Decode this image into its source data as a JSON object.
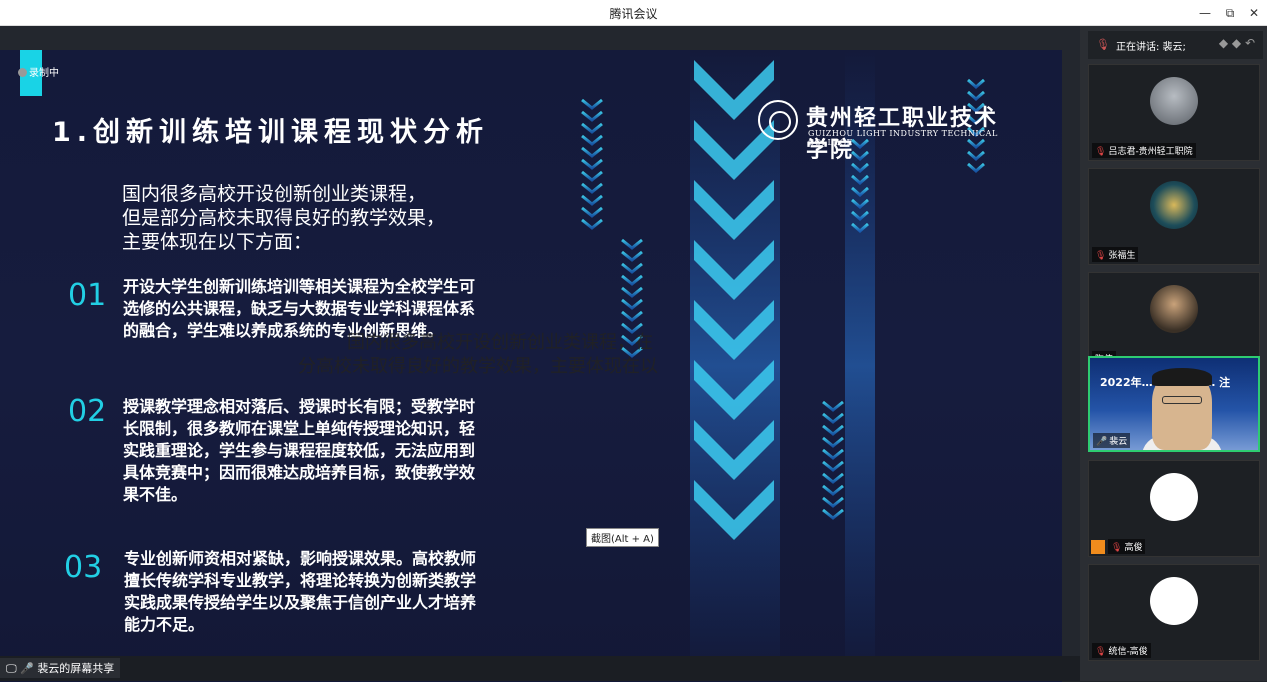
{
  "window": {
    "title": "腾讯会议",
    "minimize": "—",
    "restore": "⧉",
    "close": "✕"
  },
  "recording": {
    "label": "录制中"
  },
  "slide": {
    "title": "1.创新训练培训课程现状分析",
    "logo": {
      "cn": "贵州轻工职业技术学院",
      "en": "GUIZHOU LIGHT INDUSTRY TECHNICAL COLLEGE"
    },
    "intro": [
      "国内很多高校开设创新创业类课程，",
      "但是部分高校未取得良好的教学效果，",
      "主要体现在以下方面："
    ],
    "points": [
      {
        "num": "01",
        "lines": [
          "开设大学生创新训练培训等相关课程为全校学生可",
          "选修的公共课程，缺乏与大数据专业学科课程体系",
          "的融合，学生难以养成系统的专业创新思维。"
        ]
      },
      {
        "num": "02",
        "lines": [
          "授课教学理念相对落后、授课时长有限；受教学时",
          "长限制，很多教师在课堂上单纯传授理论知识，轻",
          "实践重理论，学生参与课程程度较低，无法应用到",
          "具体竞赛中；因而很难达成培养目标，致使教学效",
          "果不佳。"
        ]
      },
      {
        "num": "03",
        "lines": [
          "专业创新师资相对紧缺，影响授课效果。高校教师",
          "擅长传统学科专业教学，将理论转换为创新类教学",
          "实践成果传授给学生以及聚焦于信创产业人才培养",
          "能力不足。"
        ]
      }
    ],
    "overlay": [
      "国内很多高校开设创新创业类课程，在",
      "分高校未取得良好的教学效果，主要体现在以"
    ]
  },
  "tooltip": {
    "label": "截图(Alt + A)"
  },
  "share": {
    "label": "裴云的屏幕共享"
  },
  "speaker": {
    "label": "正在讲话: 裴云;"
  },
  "participants": [
    {
      "name": "吕志君-贵州轻工职院"
    },
    {
      "name": "张福生"
    },
    {
      "name": "陶伟"
    },
    {
      "name": "裴云",
      "video_title": "2022年… 应用 人才… 注"
    },
    {
      "name": "高俊"
    },
    {
      "name": "统信-高俊"
    }
  ],
  "colors": {
    "accent": "#19d3e6",
    "number": "#22cfe4",
    "slide_bg": "#141a3a",
    "active_border": "#2ecc71"
  }
}
